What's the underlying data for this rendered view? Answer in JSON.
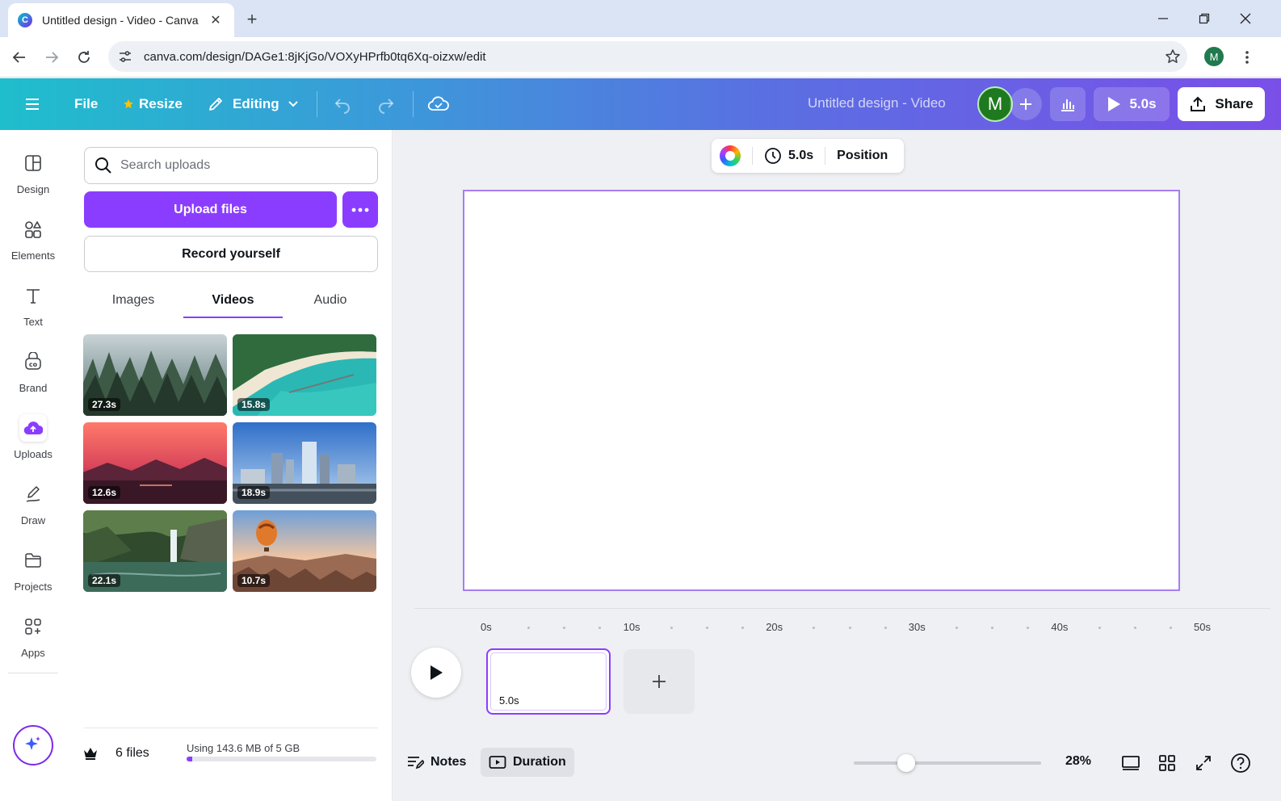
{
  "browser": {
    "tab_title": "Untitled design - Video - Canva",
    "favicon_letter": "C",
    "tab_close_glyph": "✕",
    "new_tab_glyph": "+",
    "url": "canva.com/design/DAGe1:8jKjGo/VOXyHPrfb0tq6Xq-oizxw/edit",
    "profile_initial": "M"
  },
  "header": {
    "file_label": "File",
    "resize_label": "Resize",
    "editing_label": "Editing",
    "doc_title": "Untitled design - Video",
    "avatar_initial": "M",
    "play_duration": "5.0s",
    "share_label": "Share"
  },
  "rail": {
    "items": [
      {
        "label": "Design",
        "icon": "layout-icon"
      },
      {
        "label": "Elements",
        "icon": "shapes-icon"
      },
      {
        "label": "Text",
        "icon": "text-icon"
      },
      {
        "label": "Brand",
        "icon": "brand-icon"
      },
      {
        "label": "Uploads",
        "icon": "cloud-upload-icon"
      },
      {
        "label": "Draw",
        "icon": "pen-icon"
      },
      {
        "label": "Projects",
        "icon": "folder-icon"
      },
      {
        "label": "Apps",
        "icon": "apps-icon"
      }
    ],
    "active": "Uploads"
  },
  "panel": {
    "search_placeholder": "Search uploads",
    "upload_label": "Upload files",
    "record_label": "Record yourself",
    "tabs": [
      "Images",
      "Videos",
      "Audio"
    ],
    "active_tab": "Videos",
    "videos": [
      {
        "duration": "27.3s",
        "subject": "misty forest"
      },
      {
        "duration": "15.8s",
        "subject": "tropical beach"
      },
      {
        "duration": "12.6s",
        "subject": "sunset over mountains"
      },
      {
        "duration": "18.9s",
        "subject": "city skyline"
      },
      {
        "duration": "22.1s",
        "subject": "waterfall"
      },
      {
        "duration": "10.7s",
        "subject": "hot air balloon"
      }
    ],
    "files_count": "6 files",
    "storage_label": "Using 143.6 MB of 5 GB",
    "storage_used_fraction": 0.028
  },
  "canvas": {
    "toolbar_duration": "5.0s",
    "toolbar_position": "Position"
  },
  "timeline": {
    "ruler": [
      "0s",
      "10s",
      "20s",
      "30s",
      "40s",
      "50s"
    ],
    "clip_duration": "5.0s"
  },
  "bottombar": {
    "notes_label": "Notes",
    "duration_label": "Duration",
    "zoom_percent": "28%",
    "zoom_fraction": 0.28
  },
  "colors": {
    "accent": "#8b3dff",
    "header_start": "#1fbecc",
    "header_end": "#7a4fe8"
  }
}
